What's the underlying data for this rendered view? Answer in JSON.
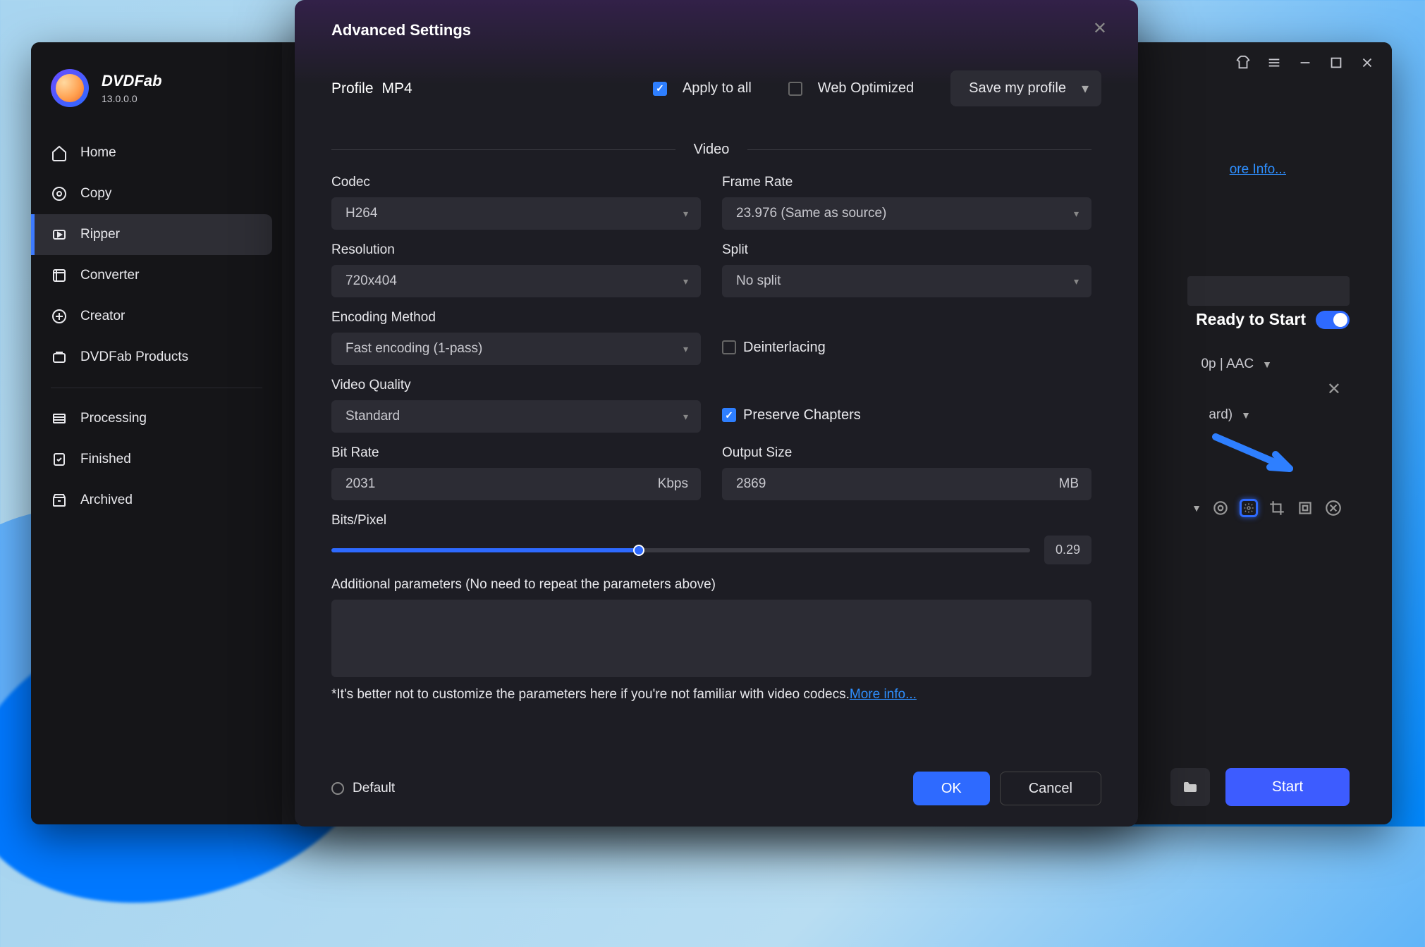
{
  "brand": {
    "name": "DVDFab",
    "version": "13.0.0.0"
  },
  "nav": {
    "home": "Home",
    "copy": "Copy",
    "ripper": "Ripper",
    "converter": "Converter",
    "creator": "Creator",
    "products": "DVDFab Products",
    "processing": "Processing",
    "finished": "Finished",
    "archived": "Archived"
  },
  "main": {
    "more_info_link": "ore Info...",
    "ready_text": "Ready to Start",
    "chip1": "0p | AAC",
    "chip2": "ard)",
    "start_btn": "Start"
  },
  "dialog": {
    "title": "Advanced Settings",
    "profile_label": "Profile",
    "profile_value": "MP4",
    "apply_to_all": "Apply to all",
    "web_optimized": "Web Optimized",
    "save_profile": "Save my profile",
    "section_video": "Video",
    "fields": {
      "codec_label": "Codec",
      "codec_value": "H264",
      "framerate_label": "Frame Rate",
      "framerate_value": "23.976 (Same as source)",
      "resolution_label": "Resolution",
      "resolution_value": "720x404",
      "split_label": "Split",
      "split_value": "No split",
      "encoding_label": "Encoding Method",
      "encoding_value": "Fast encoding (1-pass)",
      "deinterlacing": "Deinterlacing",
      "quality_label": "Video Quality",
      "quality_value": "Standard",
      "preserve_chapters": "Preserve Chapters",
      "bitrate_label": "Bit Rate",
      "bitrate_value": "2031",
      "bitrate_unit": "Kbps",
      "outputsize_label": "Output Size",
      "outputsize_value": "2869",
      "outputsize_unit": "MB",
      "bitspixel_label": "Bits/Pixel",
      "bitspixel_value": "0.29",
      "additional_label": "Additional parameters (No need to repeat the parameters above)",
      "hint_text": "*It's better not to customize the parameters here if you're not familiar with video codecs.",
      "hint_link": "More info..."
    },
    "footer": {
      "default": "Default",
      "ok": "OK",
      "cancel": "Cancel"
    }
  },
  "chart_data": {
    "type": "bar",
    "note": "no chart present",
    "categories": [],
    "values": []
  }
}
